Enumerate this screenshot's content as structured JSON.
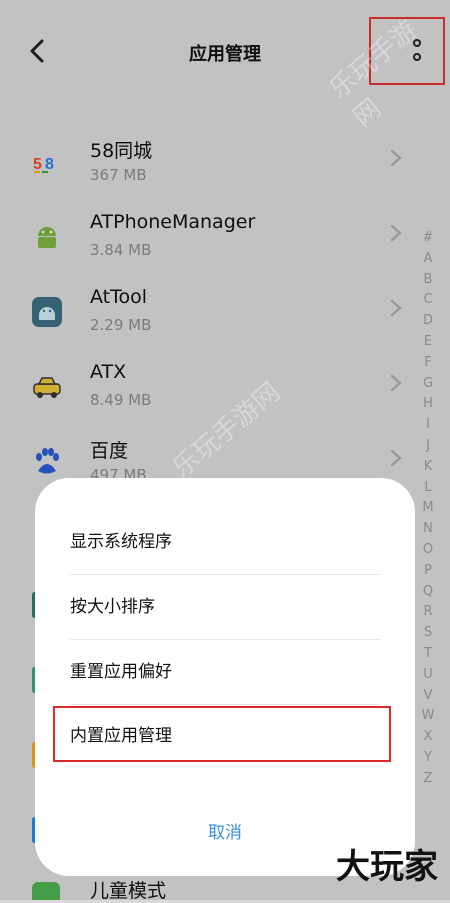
{
  "header": {
    "title": "应用管理"
  },
  "apps": [
    {
      "name": "58同城",
      "size": "367 MB",
      "icon": "58-logo-icon"
    },
    {
      "name": "ATPhoneManager",
      "size": "3.84 MB",
      "icon": "android-icon"
    },
    {
      "name": "AtTool",
      "size": "2.29 MB",
      "icon": "android-square-icon"
    },
    {
      "name": "ATX",
      "size": "8.49 MB",
      "icon": "car-icon"
    },
    {
      "name": "百度",
      "size": "497 MB",
      "icon": "baidu-paw-icon"
    }
  ],
  "alphabet": [
    "#",
    "A",
    "B",
    "C",
    "D",
    "E",
    "F",
    "G",
    "H",
    "I",
    "J",
    "K",
    "L",
    "M",
    "N",
    "O",
    "P",
    "Q",
    "R",
    "S",
    "T",
    "U",
    "V",
    "W",
    "X",
    "Y",
    "Z"
  ],
  "sheet": {
    "items": [
      "显示系统程序",
      "按大小排序",
      "重置应用偏好",
      "内置应用管理"
    ],
    "cancel": "取消"
  },
  "partial_row": {
    "name": "儿童模式"
  },
  "watermark": "大玩家",
  "watermark_faint": "乐玩手游网"
}
